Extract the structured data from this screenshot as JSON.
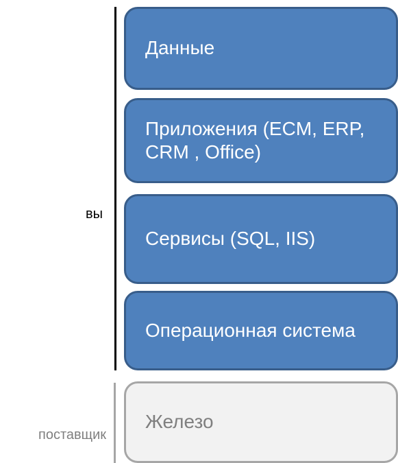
{
  "labels": {
    "you": "вы",
    "vendor": "поставщик"
  },
  "layers": [
    {
      "label": "Данные"
    },
    {
      "label": "Приложения (ECM, ERP, CRM , Office)"
    },
    {
      "label": "Сервисы (SQL, IIS)"
    },
    {
      "label": "Операционная система"
    },
    {
      "label": "Железо"
    }
  ],
  "colors": {
    "layer_fill": "#4f81bd",
    "layer_border": "#385d8a",
    "vendor_fill": "#f2f2f2",
    "vendor_border": "#a6a6a6",
    "vendor_text": "#7f7f7f"
  }
}
